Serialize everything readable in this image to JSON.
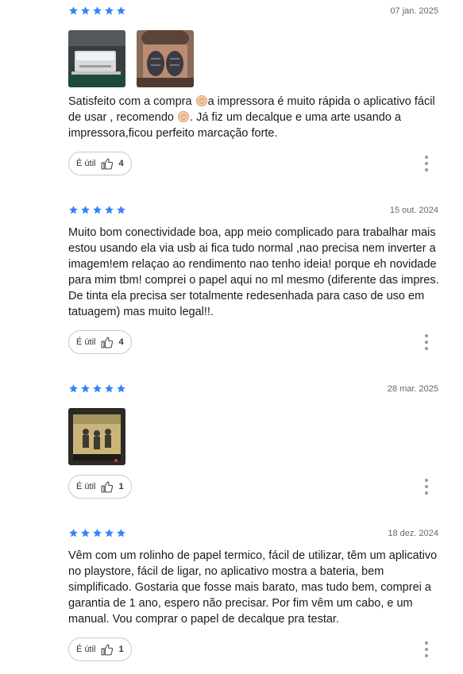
{
  "colors": {
    "star": "#3483fa",
    "border": "#c8c8c8"
  },
  "reviews": [
    {
      "rating": 5,
      "date": "07 jan. 2025",
      "photos": [
        "printer-photo",
        "neck-tattoo-photo"
      ],
      "text_before_1": "Satisfeito com a compra ",
      "text_mid": "a impressora é muito rápida o aplicativo fácil de usar , recomendo ",
      "text_after": ". Já fiz um decalque e uma arte usando a impressora,ficou perfeito marcação forte.",
      "helpful_label": "É útil",
      "helpful_count": "4"
    },
    {
      "rating": 5,
      "date": "15 out. 2024",
      "text": "Muito bom conectividade boa, app meio complicado para trabalhar mais estou usando ela via usb ai fica tudo normal ,nao precisa nem inverter a imagem!em relaçao ao rendimento nao tenho ideia! porque eh novidade para mim tbm! comprei o papel aqui no ml mesmo (diferente das impres. De tinta ela precisa ser totalmente redesenhada para caso de uso em tatuagem) mas muito legal!!.",
      "helpful_label": "É útil",
      "helpful_count": "4"
    },
    {
      "rating": 5,
      "date": "28 mar. 2025",
      "photos": [
        "stencil-print-photo"
      ],
      "helpful_label": "É útil",
      "helpful_count": "1"
    },
    {
      "rating": 5,
      "date": "18 dez. 2024",
      "text": "Vêm com um rolinho de papel termico, fácil de utilizar, têm um aplicativo no playstore, fácil de ligar, no aplicativo mostra a bateria, bem simplificado. Gostaria que fosse mais barato, mas tudo bem, comprei a garantia de 1 ano, espero não precisar. Por fim vêm um cabo, e um manual. Vou comprar o papel de decalque pra testar.",
      "helpful_label": "É útil",
      "helpful_count": "1"
    }
  ]
}
